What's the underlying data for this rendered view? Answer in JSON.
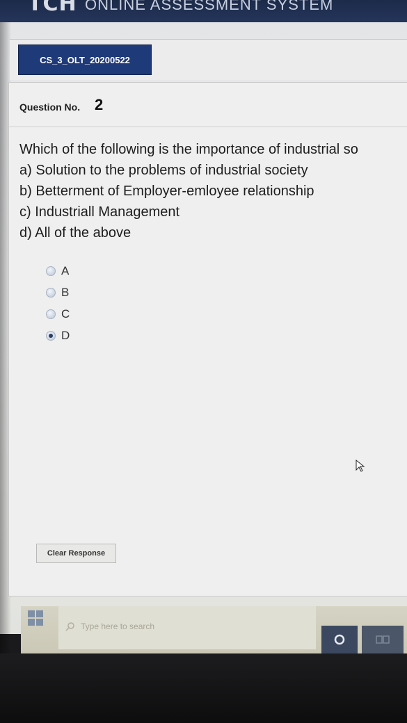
{
  "header": {
    "logo_text": "TCH",
    "system_title": "ONLINE ASSESSMENT SYSTEM"
  },
  "exam": {
    "code": "CS_3_OLT_20200522"
  },
  "question": {
    "label": "Question No.",
    "number": "2",
    "text_lines": [
      "Which of the following is the importance of industrial so",
      "a) Solution to the problems of industrial society",
      "b) Betterment of Employer-emloyee relationship",
      "c) Industriall Management",
      "d) All of the above"
    ]
  },
  "options": [
    {
      "label": "A",
      "selected": false
    },
    {
      "label": "B",
      "selected": false
    },
    {
      "label": "C",
      "selected": false
    },
    {
      "label": "D",
      "selected": true
    }
  ],
  "actions": {
    "clear_label": "Clear Response"
  },
  "taskbar": {
    "search_placeholder": "Type here to search",
    "icons": [
      "windows-start-icon",
      "search-icon",
      "cortana-icon",
      "task-view-icon"
    ]
  },
  "colors": {
    "header_bg": "#1d2b4a",
    "badge_bg": "#1f3a78"
  }
}
